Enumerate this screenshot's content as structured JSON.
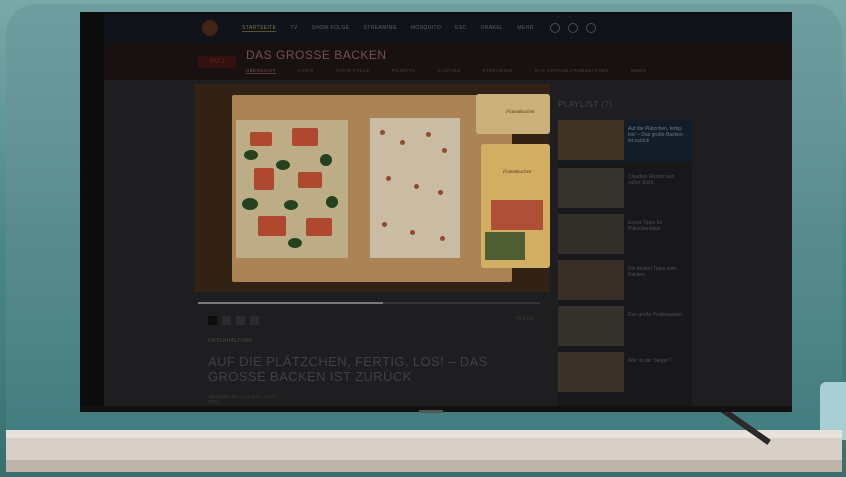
{
  "topnav": {
    "items": [
      "STARTSEITE",
      "TV",
      "SHOW FOLGE",
      "STREAMING",
      "MOSQUITO",
      "ESC",
      "ORAKEL",
      "MEHR"
    ],
    "active_index": 0
  },
  "show": {
    "logo_text": "SAT.1",
    "title": "DAS GROSSE BACKEN",
    "subnav": [
      "ÜBERSICHT",
      "VIDEO",
      "SHOW FOLGE",
      "REZEPTE",
      "CASTING",
      "STREAMING",
      "DAS GROSSE PROBEBACKEN",
      "NEWS"
    ],
    "subnav_active": 0
  },
  "video": {
    "progress": 0.54,
    "pack_label_1": "Flammkuchen",
    "pack_label_2": "Flammkuchen"
  },
  "article": {
    "pager": [
      "1",
      "2",
      "3",
      "4"
    ],
    "share_label": "TEILEN",
    "kicker": "UNTERHALTUNG",
    "headline": "AUF DIE PLÄTZCHEN, FERTIG, LOS! – DAS GROSSE BACKEN IST ZURÜCK",
    "meta": "Aktualisiert am 11.11.2019 · 14:00",
    "meta2": "SAT.1"
  },
  "playlist": {
    "title": "PLAYLIST (7)",
    "items": [
      {
        "text": "Auf die Plätzchen, fertig, los! – Das große Backen ist zurück",
        "active": true
      },
      {
        "text": "Claudias Rezept aus süßer Sicht"
      },
      {
        "text": "Enzos Tipps für Plätzchenteige"
      },
      {
        "text": "Die besten Tipps zum Backen"
      },
      {
        "text": "Das große Probebacken"
      },
      {
        "text": "Wer ist der Sieger?"
      }
    ]
  },
  "colors": {
    "accent": "#704040",
    "topbar_bg": "#13161d",
    "screen_bg": "#232325"
  }
}
